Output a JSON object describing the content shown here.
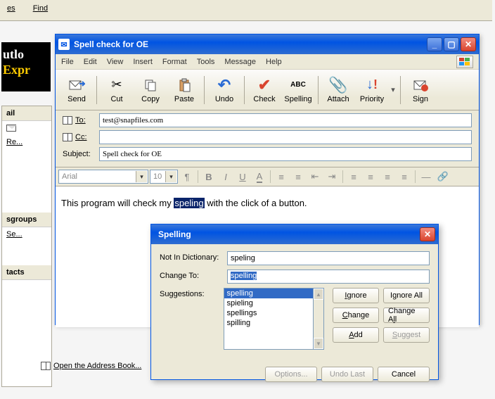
{
  "background": {
    "topmenu": {
      "es": "es",
      "find": "Find"
    },
    "logo_1": "utlo",
    "logo_2": "Expr",
    "sidebar": {
      "mail_header": "ail",
      "re": "Re...",
      "groups_header": "sgroups",
      "se": "Se...",
      "tacts_header": "tacts",
      "addrbook": "Open the Address Book..."
    }
  },
  "window": {
    "title": "Spell check for OE",
    "menubar": {
      "file": "File",
      "edit": "Edit",
      "view": "View",
      "insert": "Insert",
      "format": "Format",
      "tools": "Tools",
      "message": "Message",
      "help": "Help"
    },
    "toolbar": {
      "send": "Send",
      "cut": "Cut",
      "copy": "Copy",
      "paste": "Paste",
      "undo": "Undo",
      "check": "Check",
      "spelling": "Spelling",
      "attach": "Attach",
      "priority": "Priority",
      "sign": "Sign"
    },
    "fields": {
      "to_label": "To:",
      "to_value": "test@snapfiles.com",
      "cc_label": "Cc:",
      "cc_value": "",
      "subject_label": "Subject:",
      "subject_value": "Spell check for OE"
    },
    "format": {
      "font": "Arial",
      "size": "10"
    },
    "body": {
      "pre": "This program will check my ",
      "word": "speling",
      "post": " with the click of a button."
    }
  },
  "spell": {
    "title": "Spelling",
    "not_in_dict_label": "Not In Dictionary:",
    "not_in_dict_value": "speling",
    "change_to_label": "Change To:",
    "change_to_value": "spelling",
    "suggestions_label": "Suggestions:",
    "suggestions": [
      "spelling",
      "spieling",
      "spellings",
      "spilling"
    ],
    "buttons": {
      "ignore": "Ignore",
      "ignore_all": "Ignore All",
      "change": "Change",
      "change_all": "Change All",
      "add": "Add",
      "suggest": "Suggest",
      "options": "Options...",
      "undo_last": "Undo Last",
      "cancel": "Cancel"
    }
  }
}
